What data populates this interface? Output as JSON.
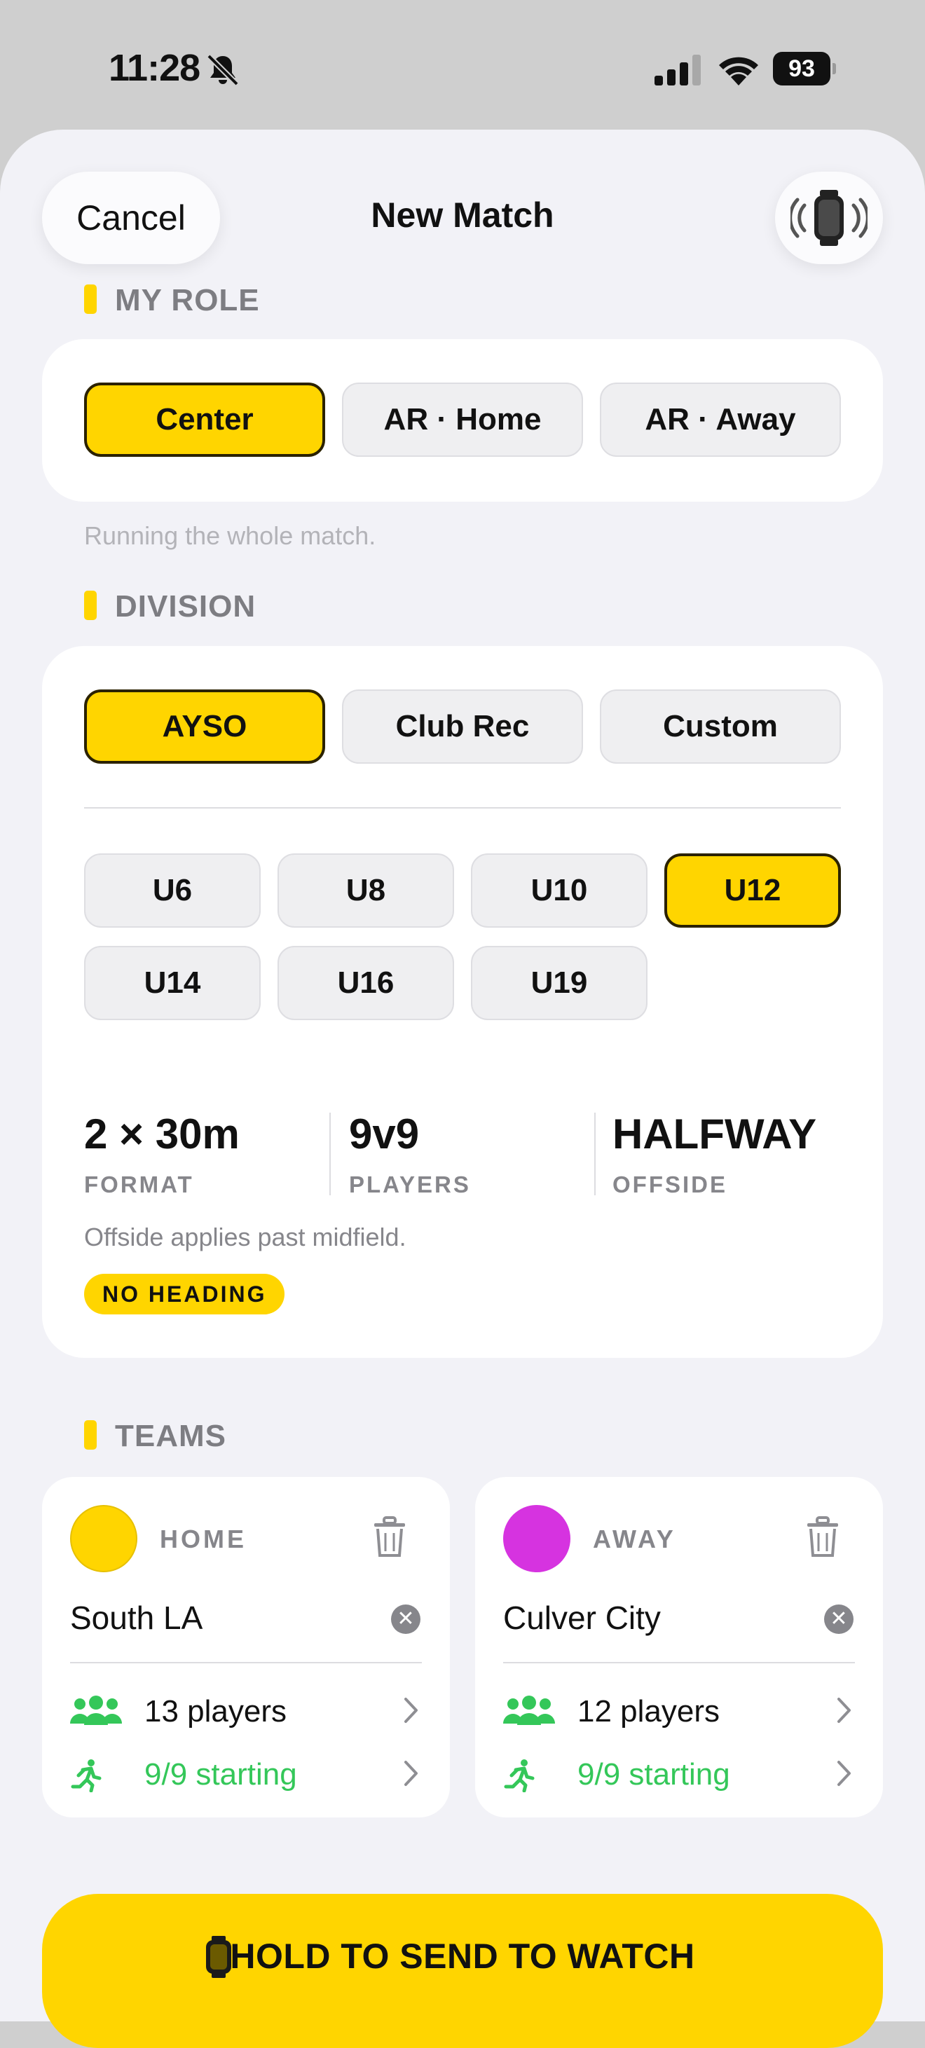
{
  "status": {
    "time": "11:28",
    "battery": "93"
  },
  "header": {
    "cancel_label": "Cancel",
    "title": "New Match"
  },
  "role": {
    "section_label": "MY ROLE",
    "options": [
      "Center",
      "AR · Home",
      "AR · Away"
    ],
    "selected": "Center",
    "hint": "Running the whole match."
  },
  "division": {
    "section_label": "DIVISION",
    "leagues": [
      "AYSO",
      "Club Rec",
      "Custom"
    ],
    "selected_league": "AYSO",
    "ages": [
      "U6",
      "U8",
      "U10",
      "U12",
      "U14",
      "U16",
      "U19"
    ],
    "selected_age": "U12",
    "stats": [
      {
        "value": "2 × 30m",
        "label": "FORMAT"
      },
      {
        "value": "9v9",
        "label": "PLAYERS"
      },
      {
        "value": "HALFWAY",
        "label": "OFFSIDE"
      }
    ],
    "note": "Offside applies past midfield.",
    "badge": "NO HEADING"
  },
  "teams": {
    "section_label": "TEAMS",
    "home": {
      "label": "HOME",
      "name": "South LA",
      "color": "#ffd500",
      "players": "13 players",
      "starting": "9/9 starting"
    },
    "away": {
      "label": "AWAY",
      "name": "Culver City",
      "color": "#d633e0",
      "players": "12 players",
      "starting": "9/9 starting"
    }
  },
  "send_button": {
    "label": "HOLD TO SEND TO WATCH"
  },
  "colors": {
    "accent": "#ffd500",
    "green": "#34c759",
    "gray": "#86868b"
  }
}
